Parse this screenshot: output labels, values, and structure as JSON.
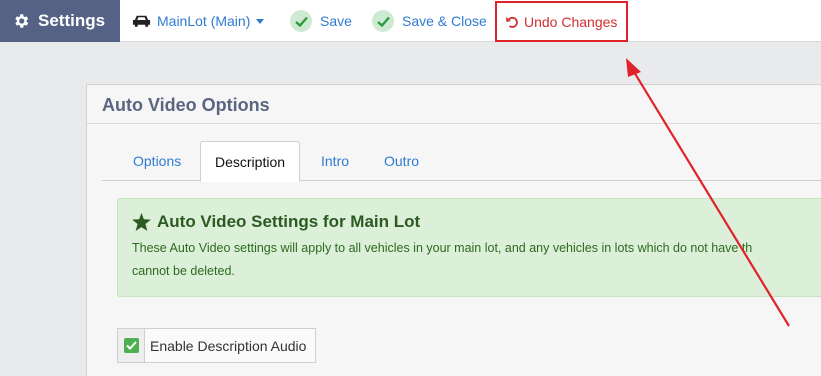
{
  "topbar": {
    "brand": "Settings",
    "lot_selector": "MainLot (Main)",
    "save_label": "Save",
    "save_close_label": "Save & Close",
    "undo_label": "Undo Changes"
  },
  "panel": {
    "title": "Auto Video Options",
    "tabs": [
      {
        "label": "Options",
        "active": false
      },
      {
        "label": "Description",
        "active": true
      },
      {
        "label": "Intro",
        "active": false
      },
      {
        "label": "Outro",
        "active": false
      }
    ],
    "alert": {
      "heading": "Auto Video Settings for Main Lot",
      "line1": "These Auto Video settings will apply to all vehicles in your main lot, and any vehicles in lots which do not have th",
      "line2": "cannot be deleted."
    },
    "checkbox": {
      "label": "Enable Description Audio",
      "checked": true
    }
  },
  "colors": {
    "brand_bg": "#556286",
    "link": "#2f7bd2",
    "undo": "#d32f2f",
    "annotation": "#e0222b",
    "alert_bg": "#dcefd8"
  }
}
